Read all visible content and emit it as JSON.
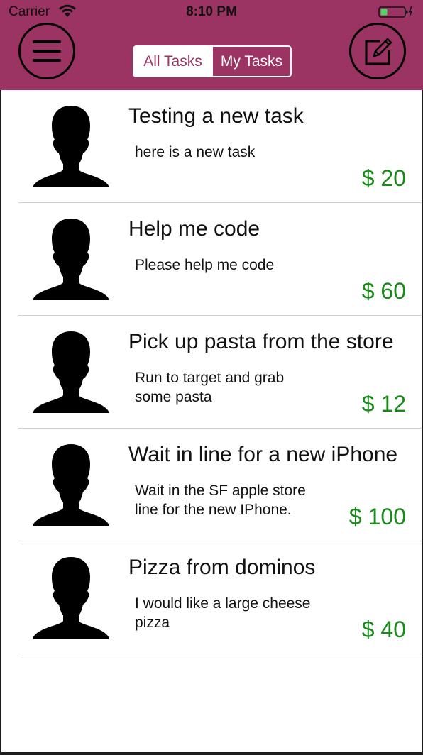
{
  "status_bar": {
    "carrier": "Carrier",
    "time": "8:10 PM",
    "wifi_icon": "wifi-icon",
    "battery_icon": "battery-charging-icon",
    "battery_color": "#4cd964"
  },
  "header": {
    "background_color": "#9b3462",
    "menu_icon": "hamburger-menu-icon",
    "compose_icon": "compose-edit-icon",
    "segments": [
      {
        "label": "All Tasks",
        "selected": true
      },
      {
        "label": "My Tasks",
        "selected": false
      }
    ]
  },
  "tasks": [
    {
      "title": "Testing a new task",
      "description": "here is a new task",
      "price": "$ 20",
      "avatar_icon": "person-silhouette-icon"
    },
    {
      "title": "Help me code",
      "description": "Please help me code",
      "price": "$ 60",
      "avatar_icon": "person-silhouette-icon"
    },
    {
      "title": "Pick up pasta from the store",
      "description": "Run to target and grab some pasta",
      "price": "$ 12",
      "avatar_icon": "person-silhouette-icon"
    },
    {
      "title": "Wait in line for a new iPhone",
      "description": "Wait in the SF apple store line for the new IPhone.",
      "price": "$ 100",
      "avatar_icon": "person-silhouette-icon"
    },
    {
      "title": "Pizza from dominos",
      "description": "I would like a large cheese pizza",
      "price": "$ 40",
      "avatar_icon": "person-silhouette-icon"
    }
  ],
  "colors": {
    "price": "#1a8a1a",
    "accent": "#9b3462"
  }
}
